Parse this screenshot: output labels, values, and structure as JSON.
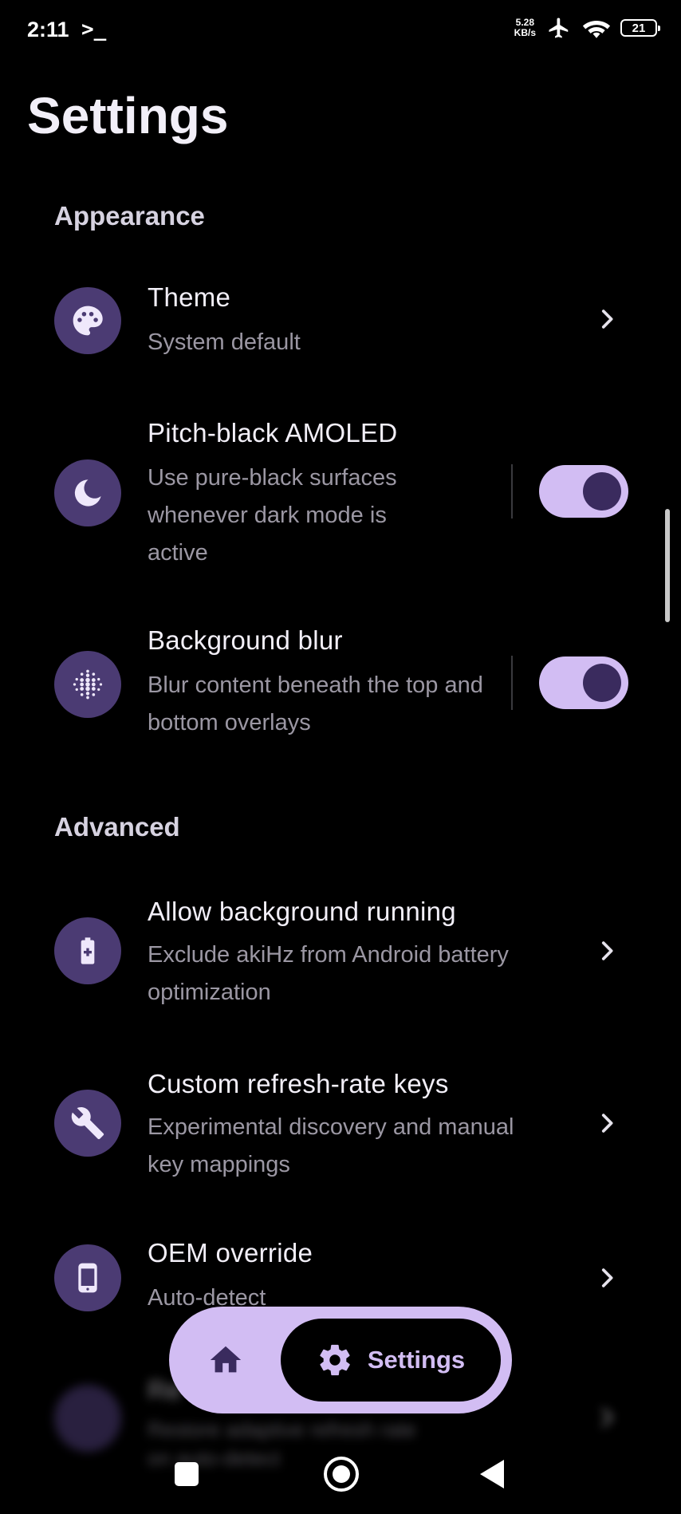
{
  "status_bar": {
    "time": "2:11",
    "terminal_glyph": ">_",
    "net_speed_value": "5.28",
    "net_speed_unit": "KB/s",
    "battery_level": "21"
  },
  "page": {
    "title": "Settings"
  },
  "sections": {
    "appearance": "Appearance",
    "advanced": "Advanced"
  },
  "settings": {
    "theme": {
      "title": "Theme",
      "subtitle": "System default",
      "icon": "palette-icon"
    },
    "amoled": {
      "title": "Pitch-black AMOLED",
      "subtitle": "Use pure-black surfaces whenever dark mode is active",
      "icon": "moon-icon",
      "enabled": true
    },
    "blur": {
      "title": "Background blur",
      "subtitle": "Blur content beneath the top and bottom overlays",
      "icon": "blur-icon",
      "enabled": true
    },
    "background_running": {
      "title": "Allow background running",
      "subtitle": "Exclude akiHz from Android battery optimization",
      "icon": "battery-plus-icon"
    },
    "refresh_keys": {
      "title": "Custom refresh-rate keys",
      "subtitle": "Experimental discovery and manual key mappings",
      "icon": "wrench-icon"
    },
    "oem_override": {
      "title": "OEM override",
      "subtitle": "Auto-detect",
      "icon": "phone-icon"
    },
    "restore": {
      "title": "Re",
      "subtitle": "Restore adaptive refresh rate",
      "subtitle_line2": "on auto-detect",
      "icon": "restore-icon"
    }
  },
  "bottom_nav": {
    "home_icon": "home-icon",
    "settings_label": "Settings",
    "settings_icon": "gear-icon"
  },
  "colors": {
    "accent": "#d2bdf3",
    "icon_bg": "#4b3b73",
    "toggle_knob": "#3a2b5e",
    "background": "#000000"
  }
}
